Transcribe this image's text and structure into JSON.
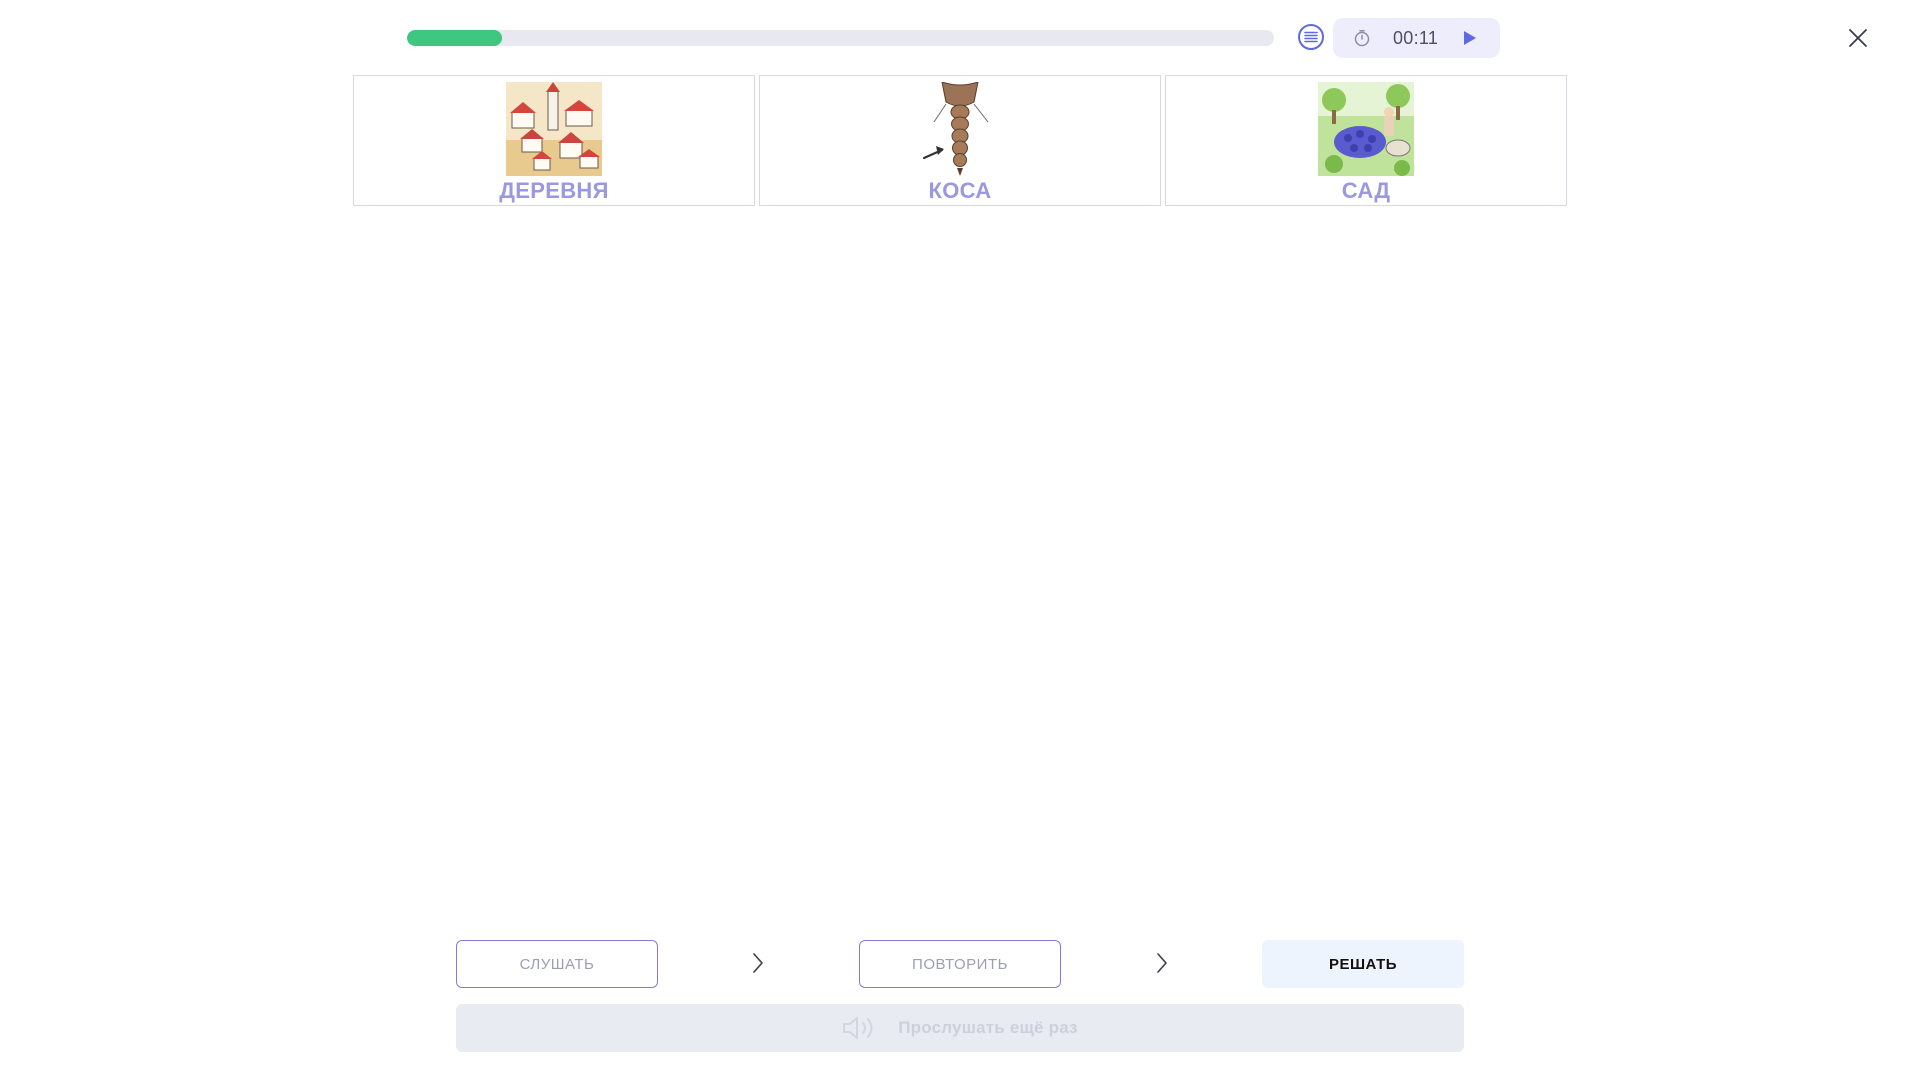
{
  "header": {
    "progress_fraction": 0.11,
    "timer": "00:11",
    "icons": {
      "list": "list-icon",
      "timer": "stopwatch-icon",
      "play": "play-icon",
      "close": "close-icon"
    }
  },
  "cards": [
    {
      "label": "ДЕРЕВНЯ",
      "image": "village-illustration"
    },
    {
      "label": "КОСА",
      "image": "braid-illustration"
    },
    {
      "label": "САД",
      "image": "garden-illustration"
    }
  ],
  "steps": {
    "listen": "СЛУШАТЬ",
    "repeat": "ПОВТОРИТЬ",
    "solve": "РЕШАТЬ"
  },
  "listen_again": {
    "label": "Прослушать ещё раз",
    "icon": "speaker-icon"
  },
  "colors": {
    "progress": "#3ec77f",
    "accent": "#5f6ae0",
    "card_label": "#9a98e0"
  }
}
